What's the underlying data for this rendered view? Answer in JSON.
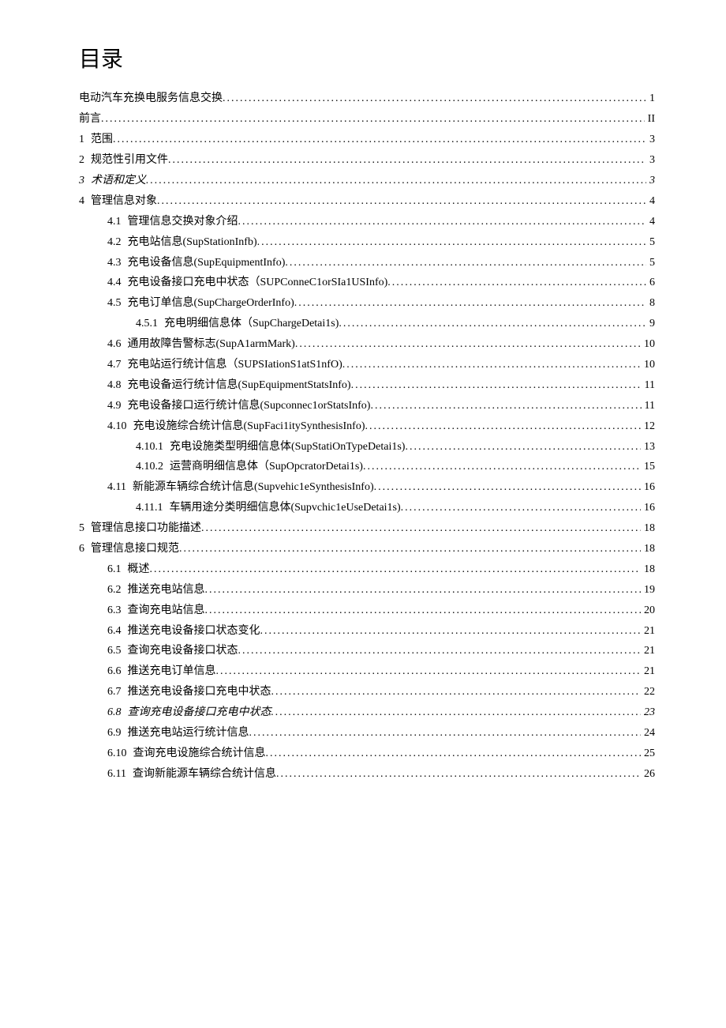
{
  "title": "目录",
  "entries": [
    {
      "indent": 0,
      "num": "",
      "label": "电动汽车充换电服务信息交换",
      "page": "1",
      "italic": false
    },
    {
      "indent": 0,
      "num": "",
      "label": "前言",
      "page": "II",
      "italic": false
    },
    {
      "indent": 0,
      "num": "1",
      "label": "范围",
      "page": "3",
      "italic": false
    },
    {
      "indent": 0,
      "num": "2",
      "label": "规范性引用文件",
      "page": "3",
      "italic": false
    },
    {
      "indent": 0,
      "num": "3",
      "label": "术语和定义",
      "page": "3",
      "italic": true
    },
    {
      "indent": 0,
      "num": "4",
      "label": "管理信息对象",
      "page": "4",
      "italic": false
    },
    {
      "indent": 1,
      "num": "4.1",
      "label": "管理信息交换对象介绍",
      "page": "4",
      "italic": false
    },
    {
      "indent": 1,
      "num": "4.2",
      "label": "充电站信息(SupStationInfb)",
      "page": "5",
      "italic": false
    },
    {
      "indent": 1,
      "num": "4.3",
      "label": "充电设备信息(SupEquipmentInfo)",
      "page": "5",
      "italic": false
    },
    {
      "indent": 1,
      "num": "4.4",
      "label": "充电设备接口充电中状态（SUPConneC1orSIa1USInfo)",
      "page": "6",
      "italic": false
    },
    {
      "indent": 1,
      "num": "4.5",
      "label": "充电订单信息(SupChargeOrderInfo)",
      "page": "8",
      "italic": false
    },
    {
      "indent": 2,
      "num": "4.5.1",
      "label": "充电明细信息体（SupChargeDetai1s)",
      "page": "9",
      "italic": false
    },
    {
      "indent": 1,
      "num": "4.6",
      "label": "通用故障告警标志(SupA1armMark)",
      "page": "10",
      "italic": false
    },
    {
      "indent": 1,
      "num": "4.7",
      "label": "充电站运行统计信息（SUPSIationS1atS1nfO)",
      "page": "10",
      "italic": false
    },
    {
      "indent": 1,
      "num": "4.8",
      "label": "充电设备运行统计信息(SupEquipmentStatsInfo)",
      "page": "11",
      "italic": false
    },
    {
      "indent": 1,
      "num": "4.9",
      "label": "充电设备接口运行统计信息(Supconnec1orStatsInfo)",
      "page": "11",
      "italic": false
    },
    {
      "indent": 1,
      "num": "4.10",
      "label": "充电设施综合统计信息(SupFaci1itySynthesisInfo)",
      "page": "12",
      "italic": false
    },
    {
      "indent": 2,
      "num": "4.10.1",
      "label": "充电设施类型明细信息体(SupStatiOnTypeDetai1s)",
      "page": "13",
      "italic": false
    },
    {
      "indent": 2,
      "num": "4.10.2",
      "label": "运营商明细信息体（SupOpcratorDetai1s)",
      "page": "15",
      "italic": false
    },
    {
      "indent": 1,
      "num": "4.11",
      "label": "新能源车辆综合统计信息(Supvehic1eSynthesisInfo)",
      "page": "16",
      "italic": false
    },
    {
      "indent": 2,
      "num": "4.11.1",
      "label": "车辆用途分类明细信息体(Supvchic1eUseDetai1s)",
      "page": "16",
      "italic": false
    },
    {
      "indent": 0,
      "num": "5",
      "label": "管理信息接口功能描述",
      "page": "18",
      "italic": false
    },
    {
      "indent": 0,
      "num": "6",
      "label": "管理信息接口规范",
      "page": "18",
      "italic": false
    },
    {
      "indent": 1,
      "num": "6.1",
      "label": "概述",
      "page": "18",
      "italic": false
    },
    {
      "indent": 1,
      "num": "6.2",
      "label": "推送充电站信息",
      "page": "19",
      "italic": false
    },
    {
      "indent": 1,
      "num": "6.3",
      "label": "查询充电站信息",
      "page": "20",
      "italic": false
    },
    {
      "indent": 1,
      "num": "6.4",
      "label": "推送充电设备接口状态变化",
      "page": "21",
      "italic": false
    },
    {
      "indent": 1,
      "num": "6.5",
      "label": "查询充电设备接口状态",
      "page": "21",
      "italic": false
    },
    {
      "indent": 1,
      "num": "6.6",
      "label": "推送充电订单信息",
      "page": "21",
      "italic": false
    },
    {
      "indent": 1,
      "num": "6.7",
      "label": "推送充电设备接口充电中状态",
      "page": "22",
      "italic": false
    },
    {
      "indent": 1,
      "num": "6.8",
      "label": "查询充电设备接口充电中状态",
      "page": "23",
      "italic": true
    },
    {
      "indent": 1,
      "num": "6.9",
      "label": "推送充电站运行统计信息",
      "page": "24",
      "italic": false
    },
    {
      "indent": 1,
      "num": "6.10",
      "label": "查询充电设施综合统计信息",
      "page": "25",
      "italic": false
    },
    {
      "indent": 1,
      "num": "6.11",
      "label": "查询新能源车辆综合统计信息",
      "page": "26",
      "italic": false
    }
  ]
}
